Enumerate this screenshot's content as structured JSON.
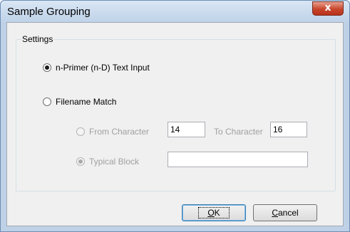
{
  "window": {
    "title": "Sample Grouping",
    "close_label": "x"
  },
  "settings": {
    "legend": "Settings",
    "options": [
      {
        "label": "n-Primer (n-D) Text Input",
        "selected": true,
        "enabled": true
      },
      {
        "label": "Filename Match",
        "selected": false,
        "enabled": true
      }
    ],
    "from_character": {
      "label": "From Character",
      "value": "14",
      "selected": false,
      "enabled": false
    },
    "to_character": {
      "label": "To Character",
      "value": "16"
    },
    "typical_block": {
      "label": "Typical Block",
      "value": "",
      "selected": true,
      "enabled": false
    }
  },
  "buttons": {
    "ok": {
      "mnemonic": "O",
      "rest": "K"
    },
    "cancel": {
      "mnemonic": "C",
      "rest": "ancel"
    }
  }
}
